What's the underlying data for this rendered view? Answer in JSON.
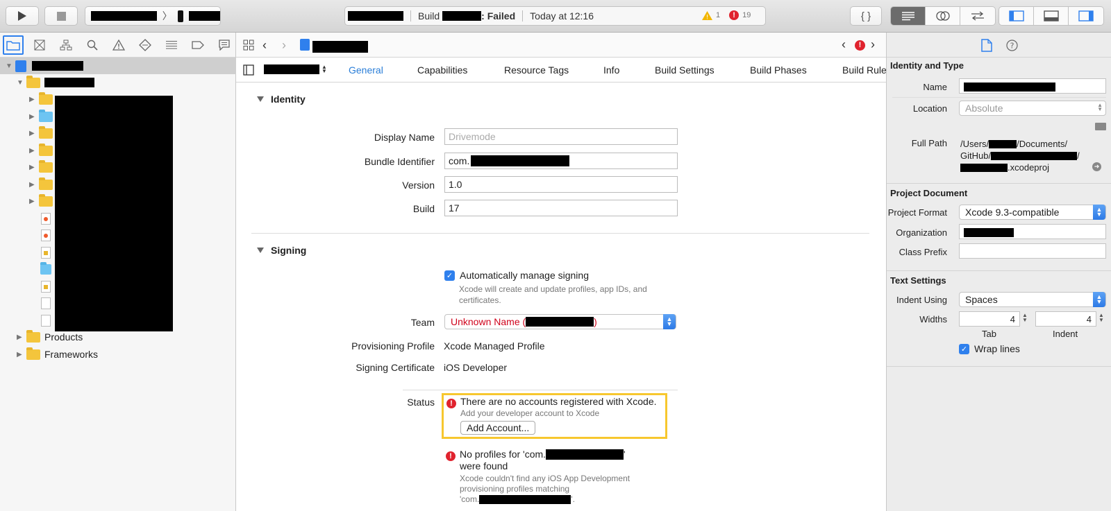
{
  "toolbar": {
    "activity_build_prefix": "Build",
    "activity_build_suffix": ": Failed",
    "activity_time": "Today at 12:16",
    "warning_count": "1",
    "error_count": "19",
    "play_icon": "play-icon",
    "stop_icon": "stop-icon"
  },
  "navigator": {
    "groups": [
      "Products",
      "Frameworks"
    ]
  },
  "editor": {
    "tabs": [
      "General",
      "Capabilities",
      "Resource Tags",
      "Info",
      "Build Settings",
      "Build Phases",
      "Build Rule"
    ],
    "identity": {
      "title": "Identity",
      "display_name_label": "Display Name",
      "display_name_placeholder": "Drivemode",
      "bundle_label": "Bundle Identifier",
      "bundle_prefix": "com.",
      "version_label": "Version",
      "version_value": "1.0",
      "build_label": "Build",
      "build_value": "17"
    },
    "signing": {
      "title": "Signing",
      "auto_manage_label": "Automatically manage signing",
      "auto_manage_checked": true,
      "auto_manage_desc": "Xcode will create and update profiles, app IDs, and certificates.",
      "team_label": "Team",
      "team_value_prefix": "Unknown Name (",
      "team_value_suffix": ")",
      "profile_label": "Provisioning Profile",
      "profile_value": "Xcode Managed Profile",
      "cert_label": "Signing Certificate",
      "cert_value": "iOS Developer",
      "status_label": "Status",
      "status_error_1": "There are no accounts registered with Xcode.",
      "status_error_1_desc": "Add your developer account to Xcode",
      "add_account_label": "Add Account...",
      "status_error_2_prefix": "No profiles for 'com.",
      "status_error_2_suffix": "'",
      "status_error_2_line2": "were found",
      "status_error_2_desc": "Xcode couldn't find any iOS App Development provisioning profiles matching",
      "status_error_2_desc_prefix": "'com.",
      "status_error_2_desc_suffix": "'."
    }
  },
  "inspector": {
    "identity_type": {
      "title": "Identity and Type",
      "name_label": "Name",
      "location_label": "Location",
      "location_value": "Absolute",
      "full_path_label": "Full Path",
      "path_line1_prefix": "/Users/",
      "path_line1_suffix": "/Documents/",
      "path_line2_prefix": "GitHub/",
      "path_line2_suffix": "/",
      "path_line3_suffix": ".xcodeproj"
    },
    "project_document": {
      "title": "Project Document",
      "format_label": "Project Format",
      "format_value": "Xcode 9.3-compatible",
      "org_label": "Organization",
      "prefix_label": "Class Prefix"
    },
    "text_settings": {
      "title": "Text Settings",
      "indent_label": "Indent Using",
      "indent_value": "Spaces",
      "widths_label": "Widths",
      "tab_value": "4",
      "indent_width_value": "4",
      "tab_caption": "Tab",
      "indent_caption": "Indent",
      "wrap_label": "Wrap lines",
      "wrap_checked": true
    }
  }
}
